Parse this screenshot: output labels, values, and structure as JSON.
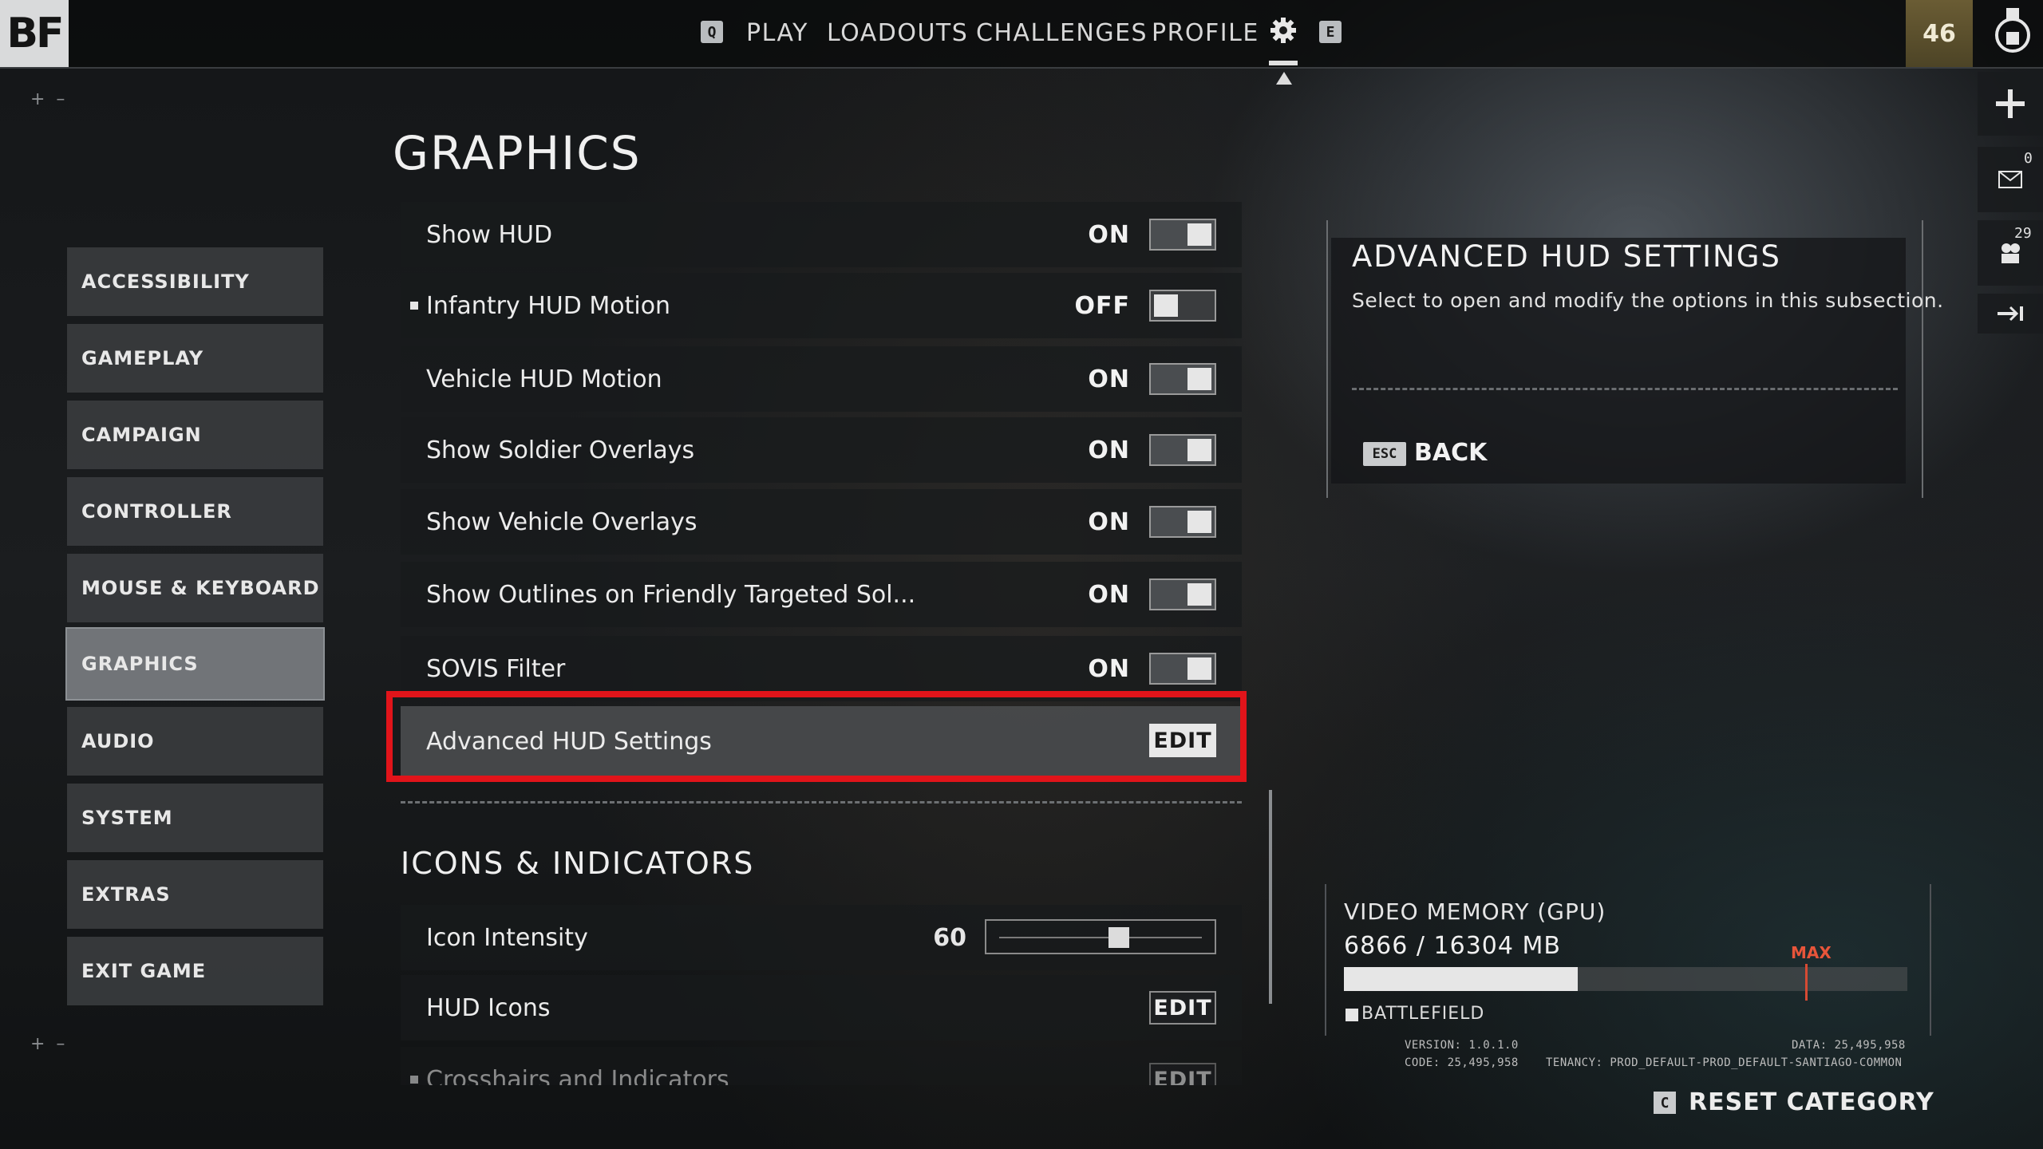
{
  "topbar": {
    "logo": "BF",
    "left_key": "Q",
    "nav": [
      "PLAY",
      "LOADOUTS",
      "CHALLENGES",
      "PROFILE"
    ],
    "right_key": "E",
    "level": "46"
  },
  "rail": {
    "mail_count": "0",
    "squad_count": "29"
  },
  "sidebar": {
    "items": [
      {
        "label": "ACCESSIBILITY"
      },
      {
        "label": "GAMEPLAY"
      },
      {
        "label": "CAMPAIGN"
      },
      {
        "label": "CONTROLLER"
      },
      {
        "label": "MOUSE & KEYBOARD"
      },
      {
        "label": "GRAPHICS"
      },
      {
        "label": "AUDIO"
      },
      {
        "label": "SYSTEM"
      },
      {
        "label": "EXTRAS"
      },
      {
        "label": "EXIT GAME"
      }
    ],
    "active": "GRAPHICS"
  },
  "main": {
    "title": "GRAPHICS",
    "rows": [
      {
        "label": "Show HUD",
        "value": "ON"
      },
      {
        "label": "Infantry HUD Motion",
        "value": "OFF"
      },
      {
        "label": "Vehicle HUD Motion",
        "value": "ON"
      },
      {
        "label": "Show Soldier Overlays",
        "value": "ON"
      },
      {
        "label": "Show Vehicle Overlays",
        "value": "ON"
      },
      {
        "label": "Show Outlines on Friendly Targeted Sol...",
        "value": "ON"
      },
      {
        "label": "SOVIS Filter",
        "value": "ON"
      },
      {
        "label": "Advanced HUD Settings",
        "action": "EDIT"
      }
    ],
    "section_title": "ICONS & INDICATORS",
    "icon_intensity": {
      "label": "Icon Intensity",
      "value": "60",
      "fraction": 0.6
    },
    "hud_icons": {
      "label": "HUD Icons",
      "action": "EDIT"
    },
    "crosshairs": {
      "label": "Crosshairs and Indicators",
      "action": "EDIT"
    }
  },
  "info": {
    "title": "ADVANCED HUD SETTINGS",
    "description": "Select to open and modify the options in this subsection.",
    "back_key": "ESC",
    "back_label": "BACK"
  },
  "memory": {
    "title": "VIDEO MEMORY (GPU)",
    "value": "6866 / 16304 MB",
    "used_mb": 6866,
    "total_mb": 16304,
    "max_label": "MAX",
    "legend": "BATTLEFIELD"
  },
  "version": {
    "version": "VERSION: 1.0.1.0",
    "code": "CODE: 25,495,958",
    "data": "DATA: 25,495,958",
    "tenancy": "TENANCY: PROD_DEFAULT-PROD_DEFAULT-SANTIAGO-COMMON"
  },
  "reset": {
    "key": "C",
    "label": "RESET CATEGORY"
  },
  "colors": {
    "highlight": "#e1141a",
    "level_badge": "#5a4f2c",
    "max_marker": "#d64a33"
  }
}
